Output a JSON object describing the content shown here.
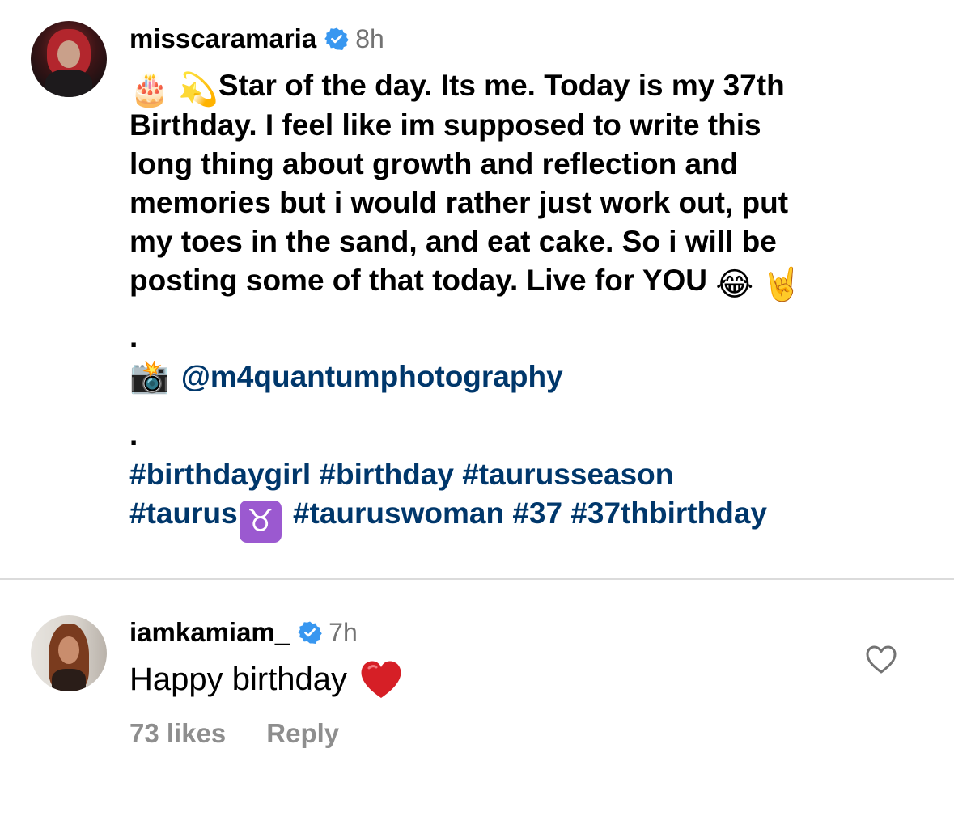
{
  "post": {
    "username": "misscaramaria",
    "time": "8h",
    "caption_lines": [
      "Star of the day. Its me. Today is my 37th",
      "Birthday. I feel like im supposed to write this",
      "long thing about growth and reflection and",
      "memories but i would rather just work out, put",
      "my toes in the sand, and eat cake. So i will be",
      "posting some of that today. Live for YOU"
    ],
    "caption_emojis": {
      "lead_1": "🎂",
      "lead_2": "💫",
      "tail_1": "😂",
      "tail_2": "🤘"
    },
    "dot_1": ".",
    "camera_emoji": "📸",
    "photographer_mention": "@m4quantumphotography",
    "dot_2": ".",
    "hashtags_line1": [
      "#birthdaygirl",
      "#birthday",
      "#taurusseason"
    ],
    "hashtag_taurus": "#taurus",
    "taurus_symbol": "♉",
    "hashtags_line2": [
      "#tauruswoman",
      "#37",
      "#37thbirthday"
    ]
  },
  "comment": {
    "username": "iamkamiam_",
    "time": "7h",
    "text": "Happy birthday",
    "heart": "❤️",
    "likes": "73 likes",
    "reply_label": "Reply"
  },
  "icons": {
    "verified": "verified-badge-icon",
    "like": "heart-outline-icon"
  },
  "colors": {
    "verified_blue": "#3897f0",
    "link_blue": "#00376b",
    "meta_gray": "#8e8e8e",
    "time_gray": "#737373",
    "taurus_purple": "#9b59d0",
    "divider": "#dbdbdb"
  }
}
